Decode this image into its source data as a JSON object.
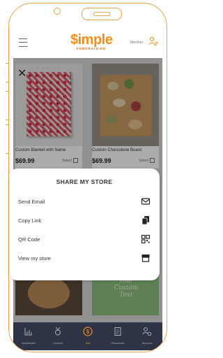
{
  "header": {
    "logo_main": "$imple",
    "logo_sub": "FUNDRAISING",
    "member_label": "Member"
  },
  "products": [
    {
      "name": "Custom Blanket with Name",
      "price": "$69.99",
      "select_label": "Select"
    },
    {
      "name": "Custom Charcuterie Board",
      "price": "$69.99",
      "select_label": "Select"
    },
    {
      "name": "",
      "price": "",
      "select_label": ""
    },
    {
      "name": "",
      "price": "",
      "select_label": ""
    }
  ],
  "lower_card_text": "Your Custom Text",
  "share": {
    "title": "SHARE MY STORE",
    "items": [
      {
        "label": "Send Email",
        "icon": "envelope-icon"
      },
      {
        "label": "Copy Link",
        "icon": "copy-icon"
      },
      {
        "label": "QR Code",
        "icon": "qr-code-icon"
      },
      {
        "label": "View my store",
        "icon": "storefront-icon"
      }
    ]
  },
  "nav": {
    "items": [
      {
        "label": "Dashboard",
        "icon": "chart-icon"
      },
      {
        "label": "Contest",
        "icon": "trophy-icon"
      },
      {
        "label": "Sell",
        "icon": "dollar-icon"
      },
      {
        "label": "Resources",
        "icon": "document-icon"
      },
      {
        "label": "Account",
        "icon": "account-settings-icon"
      }
    ],
    "active": "Sell"
  },
  "colors": {
    "accent": "#f0901e",
    "nav_bg": "#2e3445",
    "phone_outline": "#e8a24b"
  }
}
